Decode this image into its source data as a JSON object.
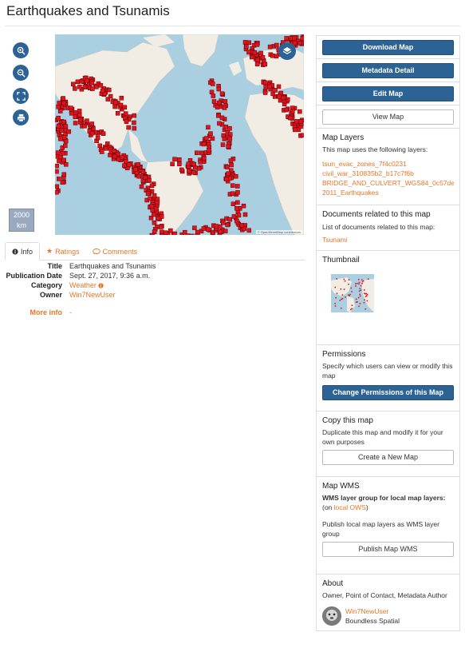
{
  "page": {
    "title": "Earthquakes and Tsunamis"
  },
  "map": {
    "scale_label": "2000 km",
    "attribution": "© OpenStreetMap contributors",
    "tools": [
      "zoom-in-icon",
      "zoom-out-icon",
      "fullscreen-icon",
      "print-icon"
    ]
  },
  "tabs": [
    {
      "label": "Info",
      "icon": "info-icon",
      "active": true
    },
    {
      "label": "Ratings",
      "icon": "star-icon",
      "active": false
    },
    {
      "label": "Comments",
      "icon": "comment-icon",
      "active": false
    }
  ],
  "info": {
    "title_label": "Title",
    "title_value": "Earthquakes and Tsunamis",
    "date_label": "Publication Date",
    "date_value": "Sept. 27, 2017, 9:36 a.m.",
    "category_label": "Category",
    "category_value": "Weather",
    "owner_label": "Owner",
    "owner_value": "Win7NewUser",
    "more_label": "More info",
    "more_value": "-"
  },
  "sidebar": {
    "download_label": "Download Map",
    "metadata_label": "Metadata Detail",
    "edit_label": "Edit Map",
    "view_label": "View Map",
    "layers": {
      "heading": "Map Layers",
      "intro": "This map uses the following layers:",
      "items": [
        "tsun_evac_zones_7f4c0231",
        "civil_war_310835b2_b17c7f6b",
        "BRIDGE_AND_CULVERT_WGS84_0c57de1f",
        "2011_Earthquakes"
      ]
    },
    "documents": {
      "heading": "Documents related to this map",
      "intro": "List of documents related to this map:",
      "items": [
        "Tsunami"
      ]
    },
    "thumbnail": {
      "heading": "Thumbnail"
    },
    "permissions": {
      "heading": "Permissions",
      "text": "Specify which users can view or modify this map",
      "button": "Change Permissions of this Map"
    },
    "copy": {
      "heading": "Copy this map",
      "text": "Duplicate this map and modify it for your own purposes",
      "button": "Create a New Map"
    },
    "wms": {
      "heading": "Map WMS",
      "group_label": "WMS layer group for local map layers:",
      "on_prefix": "(on ",
      "on_link": "local OWS",
      "on_suffix": ")",
      "text": "Publish local map layers as WMS layer group",
      "button": "Publish Map WMS"
    },
    "about": {
      "heading": "About",
      "text": "Owner, Point of Contact, Metadata Author",
      "user": "Win7NewUser",
      "org": "Boundless Spatial"
    }
  },
  "colors": {
    "accent": "#e57628",
    "primary": "#2c6394",
    "ocean": "#a9cfe1",
    "land": "#f1ede4",
    "marker": "#e0141e"
  }
}
